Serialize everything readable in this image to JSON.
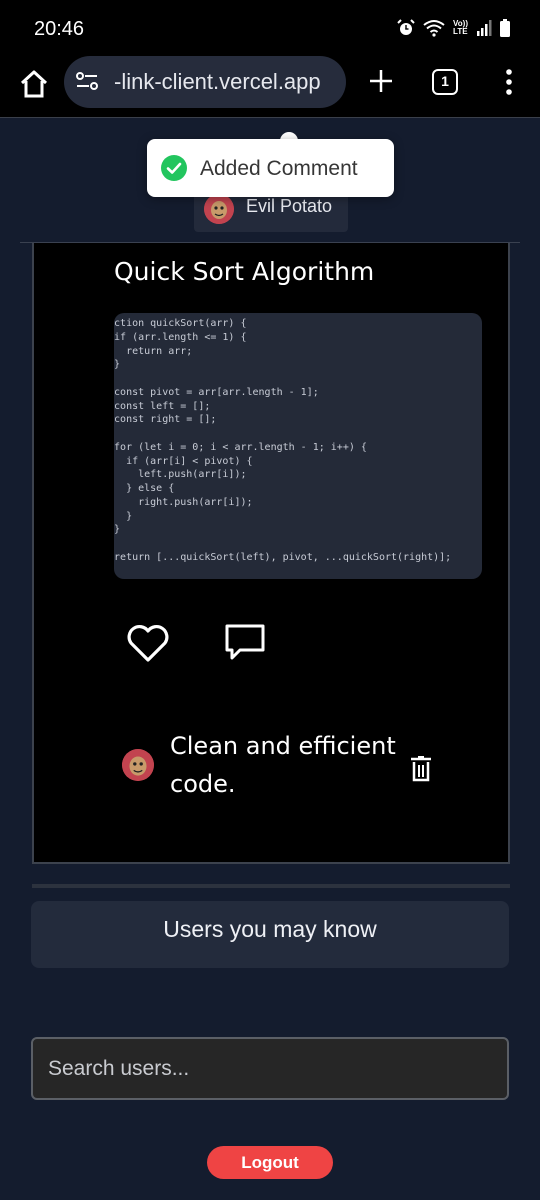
{
  "status_bar": {
    "time": "20:46",
    "icons": [
      "alarm-icon",
      "wifi-icon",
      "volte-icon",
      "signal-icon",
      "battery-icon"
    ],
    "volte_label": "Vo))\nLTE"
  },
  "browser": {
    "url": "-link-client.vercel.app",
    "tab_count": "1"
  },
  "toast": {
    "message": "Added Comment"
  },
  "post": {
    "author": "Evil Potato",
    "title": "Quick Sort Algorithm",
    "code": "unction quickSort(arr) {\n  if (arr.length <= 1) {\n    return arr;\n  }\n\n  const pivot = arr[arr.length - 1];\n  const left = [];\n  const right = [];\n\n  for (let i = 0; i < arr.length - 1; i++) {\n    if (arr[i] < pivot) {\n      left.push(arr[i]);\n    } else {\n      right.push(arr[i]);\n    }\n  }\n\n  return [...quickSort(left), pivot, ...quickSort(right)];\n}",
    "comments": [
      {
        "text": "Clean and efficient code."
      }
    ]
  },
  "sidebar": {
    "suggest_title": "Users you may know",
    "search_placeholder": "Search users...",
    "logout_label": "Logout"
  },
  "colors": {
    "page_bg": "#141c2e",
    "card_bg": "#000000",
    "accent_red": "#ef4444",
    "success_green": "#22c55e"
  }
}
